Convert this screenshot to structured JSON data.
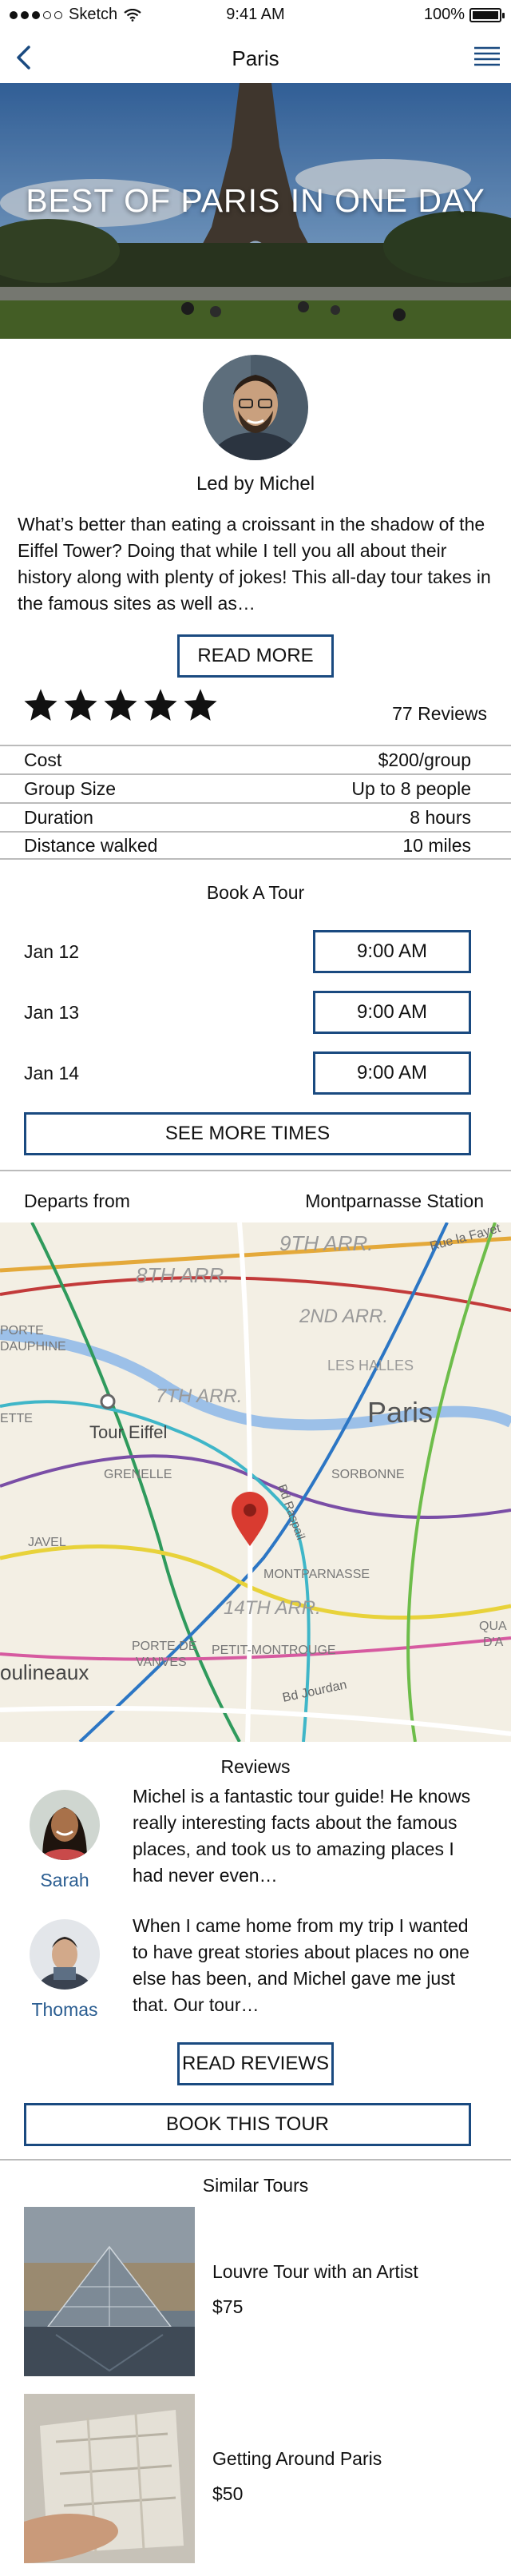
{
  "status_bar": {
    "carrier": "Sketch",
    "time": "9:41 AM",
    "battery": "100%"
  },
  "nav": {
    "title": "Paris",
    "back_icon": "chevron-left-icon",
    "menu_icon": "hamburger-menu-icon"
  },
  "hero": {
    "title": "BEST OF PARIS IN ONE DAY"
  },
  "guide": {
    "label": "Led by Michel"
  },
  "description": {
    "text": "What’s better than eating a croissant in the shadow of the Eiffel Tower? Doing that while I tell you all about their history along with plenty of jokes! This all-day tour takes in the famous sites as well as…",
    "read_more": "READ MORE"
  },
  "rating": {
    "stars": 5,
    "max": 5,
    "reviews_label": "77 Reviews"
  },
  "details": [
    {
      "label": "Cost",
      "value": "$200/group"
    },
    {
      "label": "Group Size",
      "value": "Up to 8 people"
    },
    {
      "label": "Duration",
      "value": "8 hours"
    },
    {
      "label": "Distance walked",
      "value": "10 miles"
    }
  ],
  "booking": {
    "title": "Book A Tour",
    "slots": [
      {
        "date": "Jan 12",
        "time": "9:00 AM"
      },
      {
        "date": "Jan 13",
        "time": "9:00 AM"
      },
      {
        "date": "Jan 14",
        "time": "9:00 AM"
      }
    ],
    "more": "SEE MORE TIMES"
  },
  "departure": {
    "label": "Departs from",
    "value": "Montparnasse Station"
  },
  "map": {
    "labels": [
      "9TH ARR.",
      "8TH ARR.",
      "2ND ARR.",
      "LES HALLES",
      "7TH ARR.",
      "Paris",
      "Tour Eiffel",
      "GRENELLE",
      "SORBONNE",
      "JAVEL",
      "MONTPARNASSE",
      "14TH ARR.",
      "PORTE DE VANVES",
      "PETIT-MONTROUGE",
      "oulineaux",
      "Bd Jourdan",
      "PORTE DAUPHINE",
      "ETTE",
      "Bd Raspail",
      "Rue la Fayet",
      "QUA D'A"
    ]
  },
  "reviews": {
    "title": "Reviews",
    "items": [
      {
        "name": "Sarah",
        "text": "Michel is a fantastic tour guide! He knows really interesting facts about the famous places, and took us to amazing places I had never even…"
      },
      {
        "name": "Thomas",
        "text": "When I came home from my trip I wanted to have great stories about places no one else has been, and Michel gave me just that. Our tour…"
      }
    ],
    "read_reviews": "READ REVIEWS",
    "book": "BOOK THIS TOUR"
  },
  "similar": {
    "title": "Similar Tours",
    "items": [
      {
        "name": "Louvre Tour with an Artist",
        "price": "$75"
      },
      {
        "name": "Getting Around Paris",
        "price": "$50"
      }
    ]
  },
  "colors": {
    "accent": "#1a4a80",
    "link": "#2a5d91",
    "divider": "#bbbbbb"
  }
}
